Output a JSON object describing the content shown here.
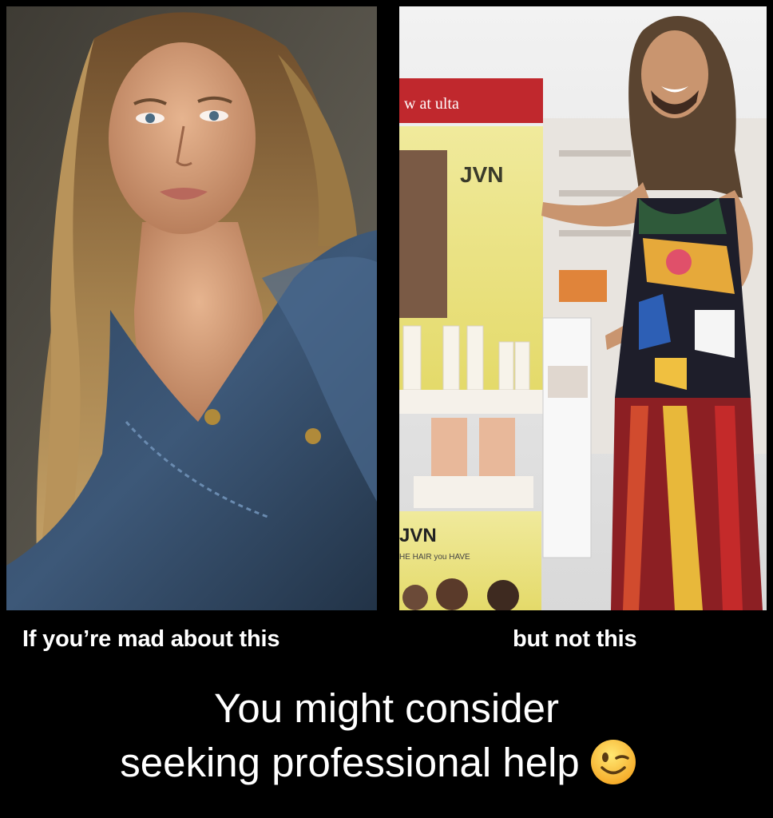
{
  "left_image": {
    "alt": "Portrait of a woman with long blonde hair wearing a low-cut denim jacket"
  },
  "right_image": {
    "alt": "Man with long curly hair in a colorful dress gesturing at a JVN hair product display in a store",
    "store_sign": "w at ulta",
    "display_brand": "JVN",
    "display_brand_lower": "JVN",
    "display_tagline": "HE HAIR you HAVE"
  },
  "captions": {
    "left": "If you’re mad about this",
    "right": "but not this",
    "main_line1": "You might consider",
    "main_line2": "seeking professional help"
  },
  "emoji": "winking-face"
}
